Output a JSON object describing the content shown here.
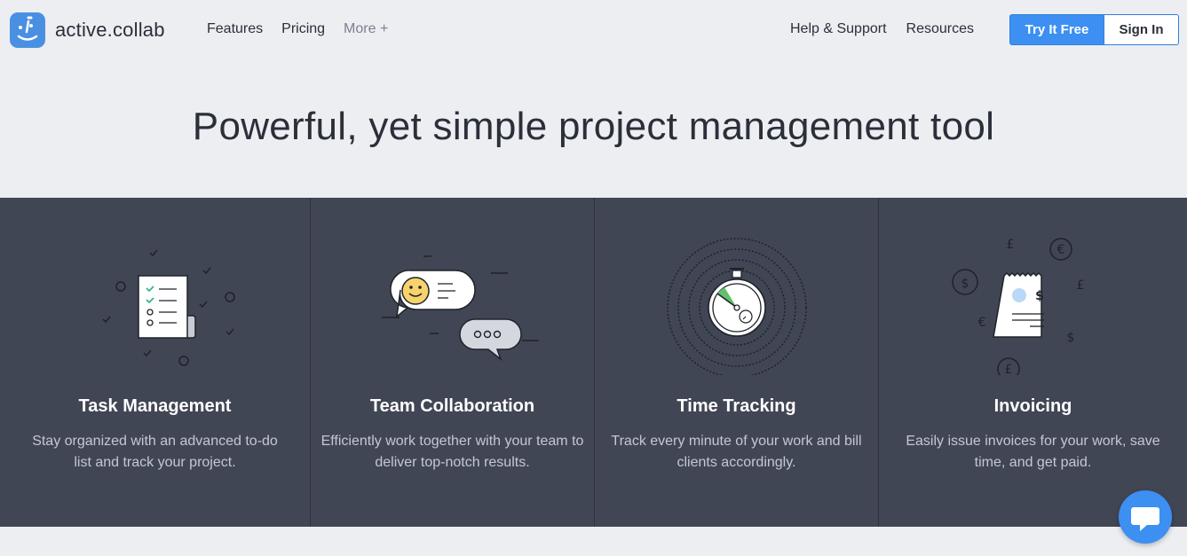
{
  "brand": {
    "name": "active.collab",
    "accent": "#4a90e2"
  },
  "nav": {
    "left": [
      "Features",
      "Pricing",
      "More +"
    ],
    "right": [
      "Help & Support",
      "Resources"
    ],
    "try_label": "Try It Free",
    "signin_label": "Sign In"
  },
  "hero": {
    "title": "Powerful, yet simple project management tool"
  },
  "features": [
    {
      "icon": "task-list-icon",
      "title": "Task Management",
      "text": "Stay organized with an advanced to-do list and track your project."
    },
    {
      "icon": "chat-icon",
      "title": "Team Collaboration",
      "text": "Efficiently work together with your team to deliver top-notch results."
    },
    {
      "icon": "stopwatch-icon",
      "title": "Time Tracking",
      "text": "Track every minute of your work and bill clients accordingly."
    },
    {
      "icon": "invoice-icon",
      "title": "Invoicing",
      "text": "Easily issue invoices for your work, save time, and get paid."
    }
  ],
  "chat_widget": {
    "icon": "chat-bubble-icon"
  }
}
